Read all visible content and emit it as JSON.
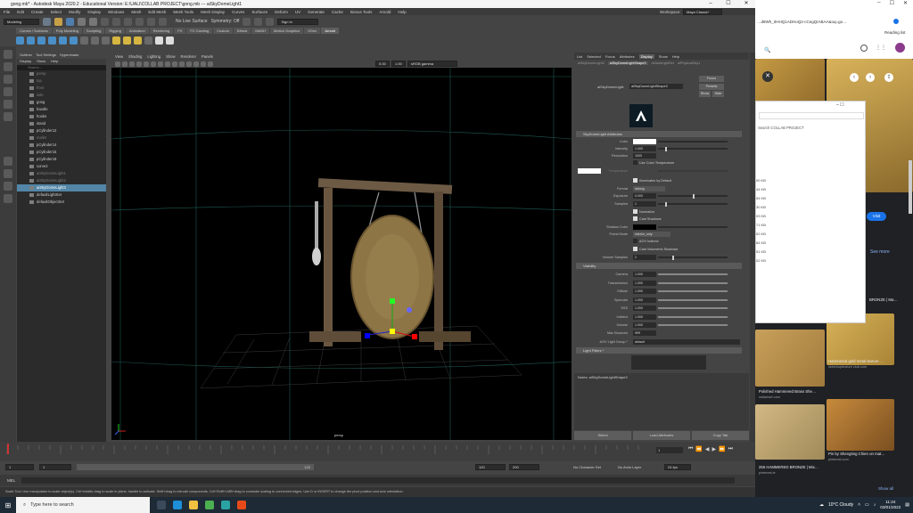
{
  "maya": {
    "title": "gong.mb* - Autodesk Maya 2020.2 - Educational Version: E:\\UALI\\COLLAB PROJECT\\gong.mb  ---  aiSkyDomeLight1",
    "menus": [
      "File",
      "Edit",
      "Create",
      "Select",
      "Modify",
      "Display",
      "Windows",
      "Mesh",
      "Edit Mesh",
      "Mesh Tools",
      "Mesh Display",
      "Curves",
      "Surfaces",
      "Deform",
      "UV",
      "Generate",
      "Cache",
      "Bonus Tools",
      "Arnold",
      "Help"
    ],
    "workspace_label": "Workspace:",
    "workspace_value": "Maya Classic*",
    "mode_dropdown": "Modeling",
    "live_surface": "No Live Surface",
    "symmetry": "Symmetry: Off",
    "sign_in": "Sign In",
    "shelf_tabs": [
      "Curves / Surfaces",
      "Poly Modeling",
      "Sculpting",
      "Rigging",
      "Animation",
      "Rendering",
      "FX",
      "FX Caching",
      "Custom",
      "Bifrost",
      "MASH",
      "Motion Graphics",
      "XGen",
      "Arnold"
    ],
    "active_shelf_tab": "Arnold"
  },
  "outliner": {
    "tabs": [
      "Outliner",
      "Tool Settings",
      "Hypershade"
    ],
    "menus": [
      "Display",
      "Show",
      "Help"
    ],
    "search_placeholder": "Search...",
    "items": [
      {
        "label": "persp",
        "state": "dim"
      },
      {
        "label": "top",
        "state": "dim"
      },
      {
        "label": "front",
        "state": "dim"
      },
      {
        "label": "side",
        "state": "dim"
      },
      {
        "label": "gong",
        "state": "normal"
      },
      {
        "label": "handle",
        "state": "normal"
      },
      {
        "label": "hooks",
        "state": "normal"
      },
      {
        "label": "stand",
        "state": "normal"
      },
      {
        "label": "pCylinder12",
        "state": "normal"
      },
      {
        "label": "mallet",
        "state": "dim"
      },
      {
        "label": "pCylinder14",
        "state": "normal"
      },
      {
        "label": "pCylinder15",
        "state": "normal"
      },
      {
        "label": "pCylinder18",
        "state": "normal"
      },
      {
        "label": "curve2",
        "state": "normal"
      },
      {
        "label": "aiSkyDomeLight1",
        "state": "dim"
      },
      {
        "label": "aiSkyDomeLight2",
        "state": "dim"
      },
      {
        "label": "aiSkyDomeLight3",
        "state": "sel"
      },
      {
        "label": "defaultLightSet",
        "state": "normal"
      },
      {
        "label": "defaultObjectSet",
        "state": "normal"
      }
    ]
  },
  "viewport": {
    "menus": [
      "View",
      "Shading",
      "Lighting",
      "Show",
      "Renderer",
      "Panels"
    ],
    "camera_label": "persp",
    "field_a": "0.00",
    "field_b": "1.00",
    "color_space": "sRGB gamma"
  },
  "attribute_editor": {
    "tabs": [
      "List",
      "Selected",
      "Focus",
      "Attributes",
      "Display",
      "Show",
      "Help"
    ],
    "active_tab": "Display",
    "node_tabs": [
      "aiSkyDomeLight3",
      "aiSkyDomeLightShape3",
      "defaultLightSet",
      "aiPhysicalSky1"
    ],
    "active_node_tab": "aiSkyDomeLightShape3",
    "node_label": "aiSkyDomeLight:",
    "node_value": "aiSkyDomeLightShape3",
    "focus_btn": "Focus",
    "presets_btn": "Presets",
    "show_btn": "Show",
    "hide_btn": "Hide",
    "section_attributes": "SkyDomeLight Attributes",
    "color_label": "Color",
    "intensity_label": "Intensity",
    "intensity_value": "1.000",
    "intensity_fraction": 0.1,
    "resolution_label": "Resolution",
    "resolution_value": "1000",
    "use_color_temp": "Use Color Temperature",
    "temperature_label": "Temperature",
    "illuminates_default": "Illuminates by Default",
    "format_label": "Format",
    "format_value": "latlong",
    "exposure_label": "Exposure",
    "exposure_value": "0.000",
    "exposure_fraction": 0.5,
    "samples_label": "Samples",
    "samples_value": "1",
    "samples_fraction": 0.1,
    "normalize": "Normalize",
    "cast_shadows": "Cast Shadows",
    "shadow_color_label": "Shadow Color",
    "portal_mode_label": "Portal Mode",
    "portal_mode_value": "interior_only",
    "aov_indirect": "AOV Indirect",
    "cast_volumetric": "Cast Volumetric Shadows",
    "volume_samples_label": "Volume Samples",
    "volume_samples_value": "2",
    "volume_samples_fraction": 0.2,
    "section_visibility": "Visibility",
    "visibility": [
      {
        "label": "Camera",
        "value": "1.000"
      },
      {
        "label": "Transmission",
        "value": "1.000"
      },
      {
        "label": "Diffuse",
        "value": "1.000"
      },
      {
        "label": "Specular",
        "value": "1.000"
      },
      {
        "label": "SSS",
        "value": "1.000"
      },
      {
        "label": "Indirect",
        "value": "1.000"
      },
      {
        "label": "Volume",
        "value": "1.000"
      }
    ],
    "max_bounces_label": "Max Bounces",
    "max_bounces_value": "999",
    "aov_group_label": "AOV Light Group *",
    "aov_group_value": "default",
    "section_filters": "Light Filters *",
    "notes_label": "Notes:  aiSkyDomeLightShape3",
    "bottom_buttons": [
      "Select",
      "Load Attributes",
      "Copy Tab"
    ]
  },
  "timeline": {
    "start": "1",
    "end": "120",
    "range_start": "1",
    "range_start2": "1",
    "range_end": "120",
    "anim_end": "120",
    "anim_end2": "200",
    "character_set": "No Character Set",
    "anim_layer": "No Anim Layer",
    "fps": "24 fps",
    "current_frame": "1"
  },
  "command_line": {
    "mel_label": "MEL"
  },
  "help_line": "Scale Tool: Use manipulator to scale object(s). Ctrl+middle-drag to scale in plane, handle to activate. Shift+drag to extrude components. Ctrl+Shift+LMB+drag to constrain scaling to connected edges. Use D or INSERT to change the pivot position and axis orientation.",
  "browser": {
    "url": "…d8Wh_0HHQ1ADHoQ2-cCegQIABAA&oq=go…",
    "reading_list": "Reading list",
    "search_placeholder": "Search COLLAB PROJECT",
    "file_sizes": [
      "00 KB",
      "44 KB",
      "54 KB",
      "30 KB",
      "03 KB",
      "71 KB",
      "52 KB",
      "84 KB",
      "51 KB",
      "02 KB"
    ],
    "visit_btn": "Visit",
    "see_more": "See more",
    "captions": [
      {
        "title": "BRONZE | Ma…",
        "source": ""
      },
      {
        "title": "Polished Hammered Brass She…",
        "source": "indiamart.com"
      },
      {
        "title": "Hammered gold metal texture …",
        "source": "sketchuptexture club.com"
      },
      {
        "title": "Pin by Shengting Chien on mat…",
        "source": "pinterest.com"
      },
      {
        "title": "256 HAMMERED BRONZE | Mix…",
        "source": "pinterest.ie"
      }
    ],
    "show_all": "Show all"
  },
  "taskbar": {
    "search_placeholder": "Type here to search",
    "weather": "10°C  Cloudy",
    "time": "11:24",
    "date": "03/01/2022"
  }
}
